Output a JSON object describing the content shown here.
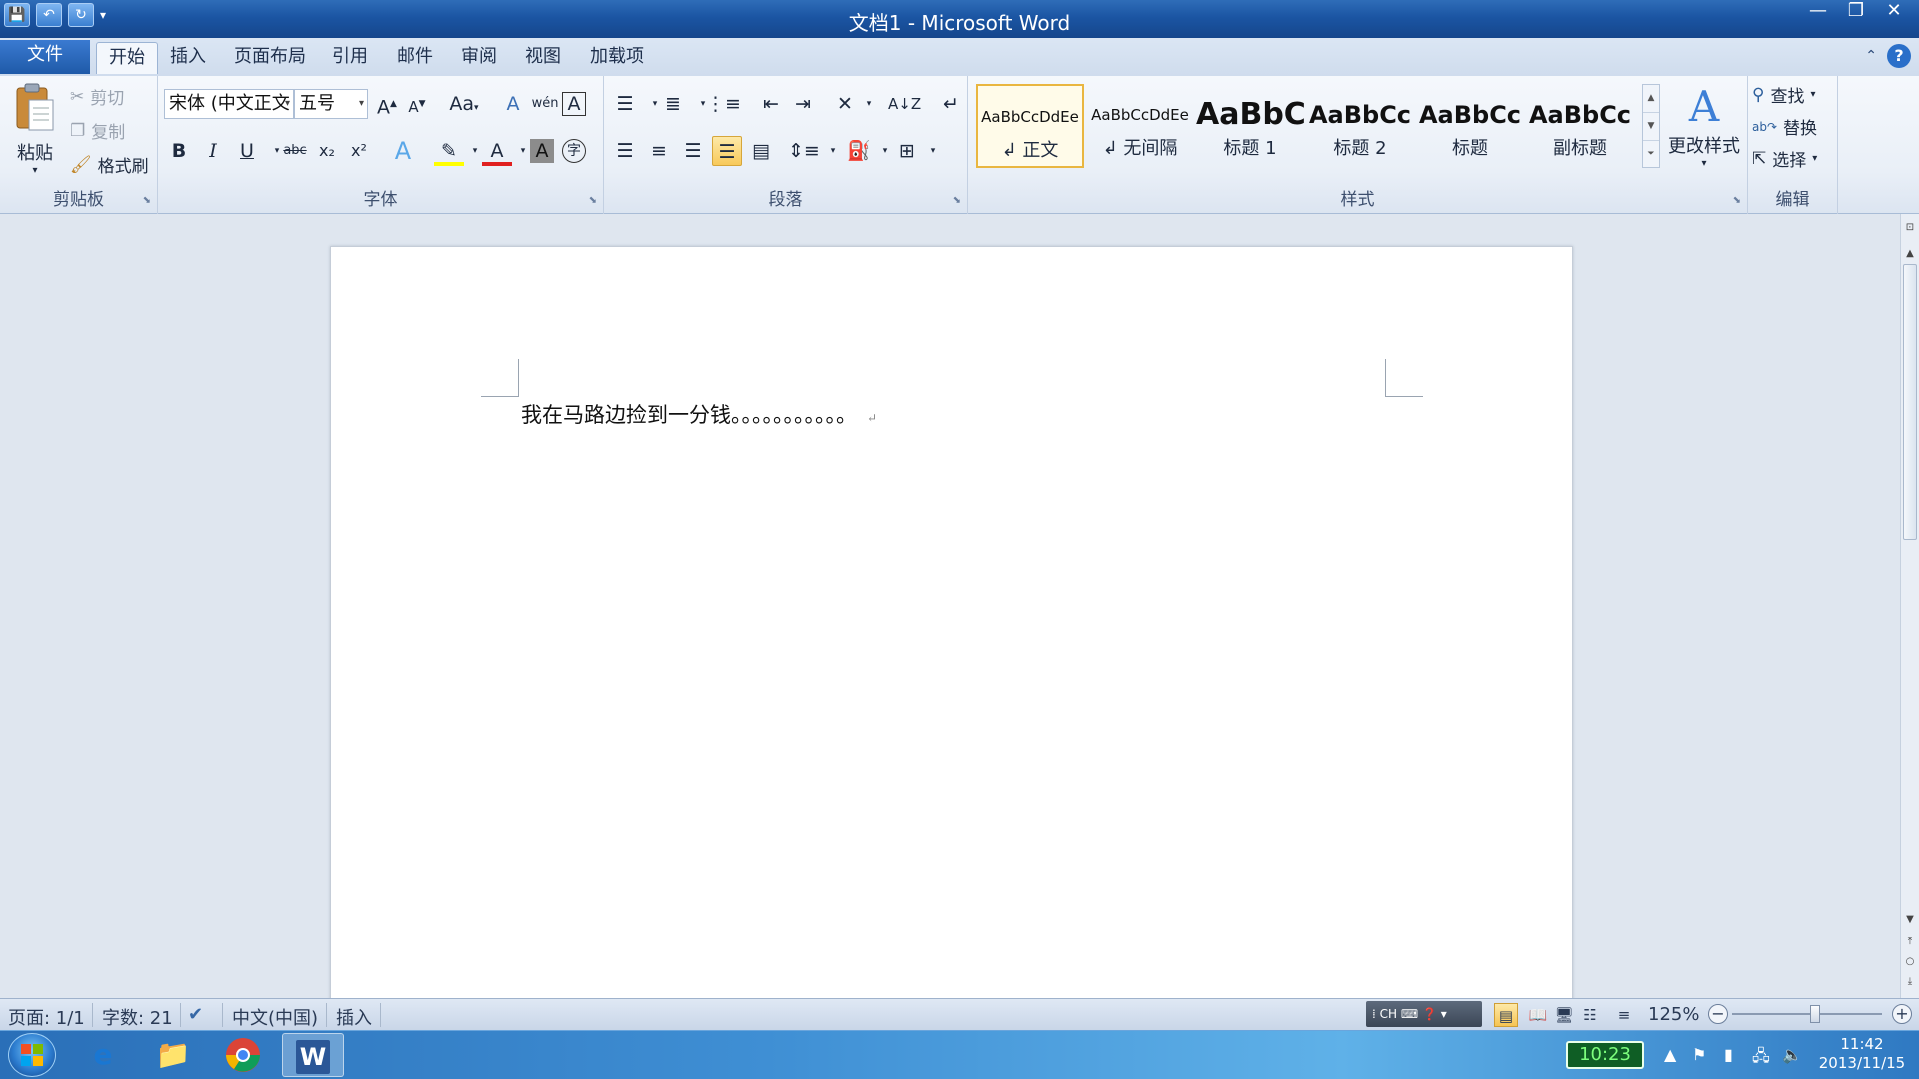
{
  "window": {
    "title": "文档1 - Microsoft Word",
    "controls": {
      "minimize": "—",
      "restore": "❐",
      "close": "✕"
    }
  },
  "quick_access": {
    "save": "💾",
    "undo": "↶",
    "redo": "↻",
    "more": "▾"
  },
  "tabs": [
    "文件",
    "开始",
    "插入",
    "页面布局",
    "引用",
    "邮件",
    "审阅",
    "视图",
    "加载项"
  ],
  "active_tab": "开始",
  "help": {
    "collapse": "⌃",
    "help": "?"
  },
  "ribbon": {
    "clipboard": {
      "label": "剪贴板",
      "paste": "粘贴",
      "cut": "剪切",
      "copy": "复制",
      "format_painter": "格式刷"
    },
    "font": {
      "label": "字体",
      "font_name": "宋体 (中文正文",
      "font_size": "五号",
      "grow": "A",
      "shrink": "A",
      "change_case": "Aa",
      "clear_format": "A",
      "phonetic": "wén",
      "char_border": "A",
      "bold": "B",
      "italic": "I",
      "underline": "U",
      "strike": "abc",
      "subscript": "x₂",
      "superscript": "x²",
      "text_effect": "A",
      "highlight": "✎",
      "font_color": "A",
      "char_shading": "A",
      "enclose": "字"
    },
    "paragraph": {
      "label": "段落"
    },
    "styles": {
      "label": "样式",
      "items": [
        {
          "preview": "AaBbCcDdEe",
          "name": "↲ 正文"
        },
        {
          "preview": "AaBbCcDdEe",
          "name": "↲ 无间隔"
        },
        {
          "preview": "AaBbC",
          "name": "标题 1"
        },
        {
          "preview": "AaBbCc",
          "name": "标题 2"
        },
        {
          "preview": "AaBbCc",
          "name": "标题"
        },
        {
          "preview": "AaBbCc",
          "name": "副标题"
        }
      ],
      "change_styles": "更改样式"
    },
    "editing": {
      "label": "编辑",
      "find": "查找",
      "replace": "替换",
      "select": "选择"
    }
  },
  "document": {
    "text": "我在马路边捡到一分钱。。。。。。。。。。。",
    "para_mark": "↵"
  },
  "status": {
    "page": "页面: 1/1",
    "words": "字数: 21",
    "language": "中文(中国)",
    "mode": "插入",
    "ime": "CH",
    "zoom": "125%"
  },
  "taskbar": {
    "battery": "10:23",
    "time": "11:42",
    "date": "2013/11/15"
  },
  "colors": {
    "highlight": "#ffff00",
    "font_color": "#e02020",
    "accent": "#1f5aa8"
  }
}
